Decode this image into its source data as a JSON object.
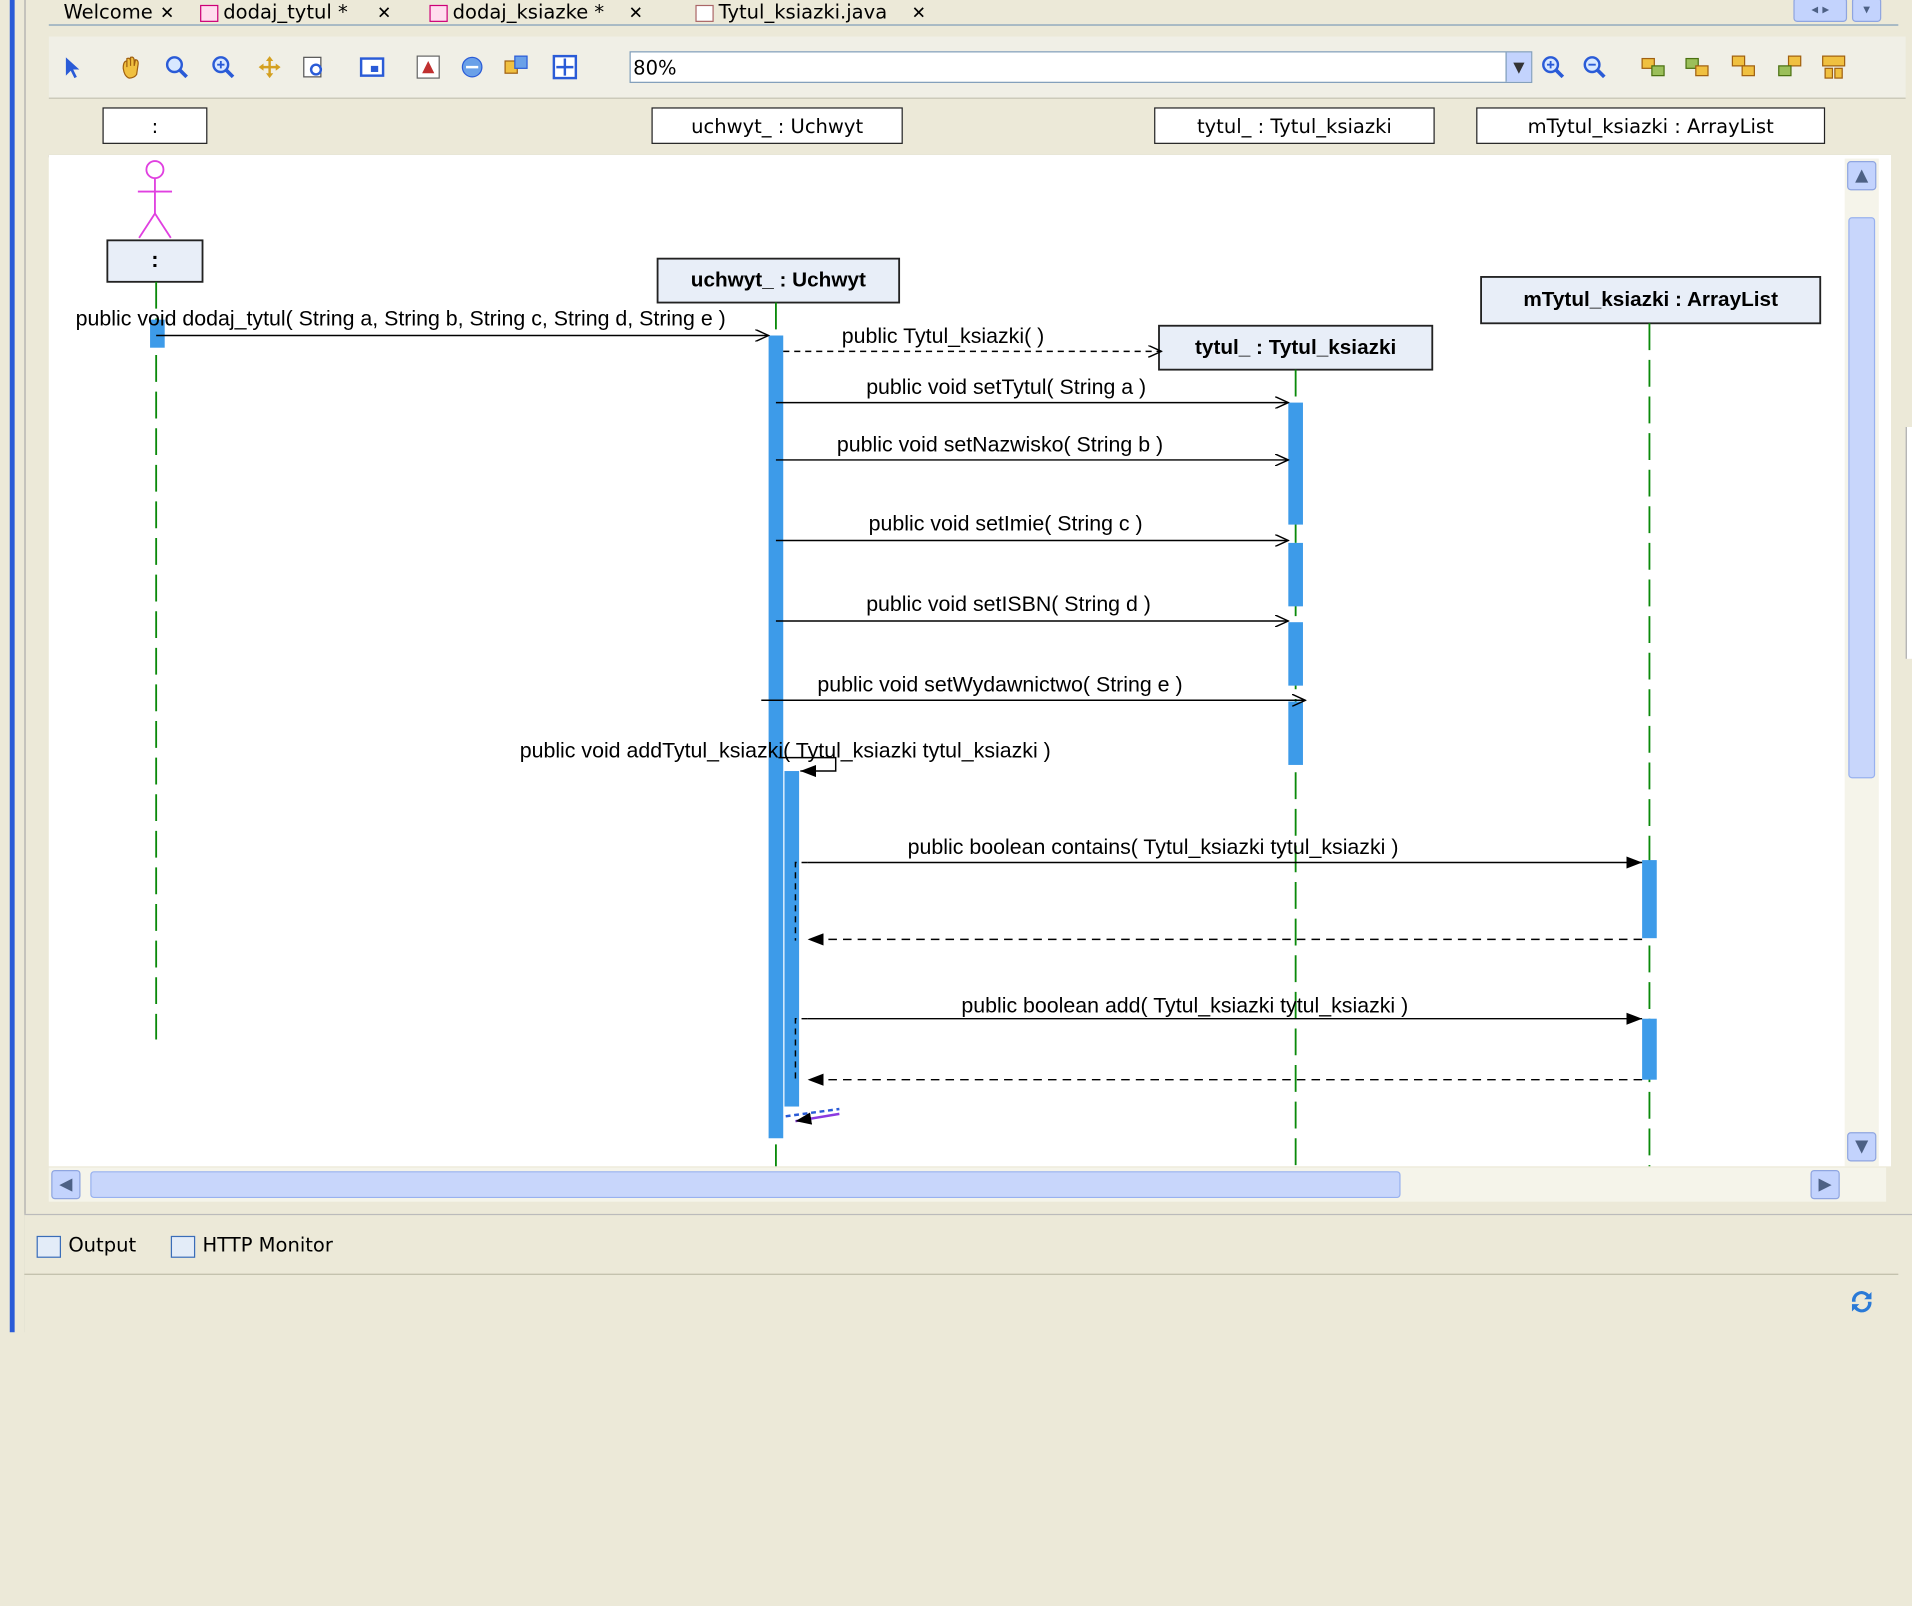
{
  "tabs": [
    {
      "label": "Welcome"
    },
    {
      "label": "dodaj_tytul *"
    },
    {
      "label": "dodaj_ksiazke *"
    },
    {
      "label": "Tytul_ksiazki.java"
    }
  ],
  "toolbar": {
    "zoom_value": "80%"
  },
  "header_boxes": [
    {
      "label": ":"
    },
    {
      "label": "uchwyt_ : Uchwyt"
    },
    {
      "label": "tytul_ : Tytul_ksiazki"
    },
    {
      "label": "mTytul_ksiazki : ArrayList"
    }
  ],
  "diagram": {
    "actor_label": ":",
    "objects": {
      "uchwyt": "uchwyt_ : Uchwyt",
      "tytul": "tytul_ : Tytul_ksiazki",
      "mtytul": "mTytul_ksiazki : ArrayList"
    },
    "messages": [
      "public void  dodaj_tytul( String a, String b, String c, String d, String e )",
      "public Tytul_ksiazki( )",
      "public void  setTytul( String a )",
      "public void  setNazwisko( String b )",
      "public void  setImie( String c )",
      "public void  setISBN( String d )",
      "public void  setWydawnictwo( String e )",
      "public void  addTytul_ksiazki( Tytul_ksiazki tytul_ksiazki )",
      "public boolean  contains( Tytul_ksiazki tytul_ksiazki )",
      "public boolean  add( Tytul_ksiazki tytul_ksiazki )"
    ]
  },
  "bottom_tabs": [
    {
      "label": "Output"
    },
    {
      "label": "HTTP Monitor"
    }
  ],
  "colors": {
    "activation": "#3d9be9",
    "actor": "#e040e0",
    "lifeline": "#0a8a0a"
  }
}
